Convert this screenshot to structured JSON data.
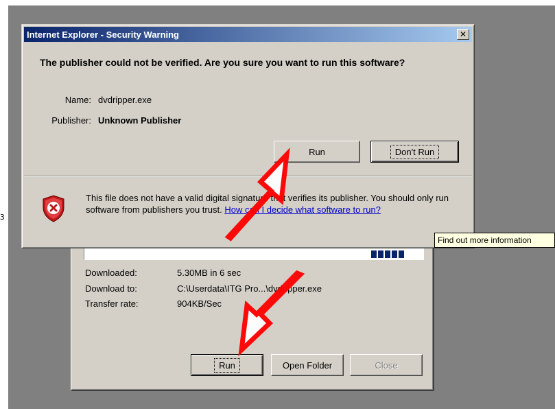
{
  "edge_mark": "3",
  "security_dialog": {
    "title": "Internet Explorer - Security Warning",
    "close_glyph": "✕",
    "question": "The publisher could not be verified.  Are you sure you want to run this software?",
    "name_label": "Name:",
    "name_value": "dvdripper.exe",
    "publisher_label": "Publisher:",
    "publisher_value": "Unknown Publisher",
    "run_button": "Run",
    "dont_run_button": "Don't Run",
    "warning_text": "This file does not have a valid digital signature that verifies its publisher. You should only run software from publishers you trust.",
    "help_link": "How can I decide what software to run?",
    "icon": "shield-x-icon"
  },
  "tooltip": "Find out more information",
  "download_dialog": {
    "progress": 0.98,
    "downloaded_label": "Downloaded:",
    "downloaded_value": "5.30MB in 6 sec",
    "download_to_label": "Download to:",
    "download_to_value": "C:\\Userdata\\ITG Pro...\\dvdripper.exe",
    "transfer_rate_label": "Transfer rate:",
    "transfer_rate_value": "904KB/Sec",
    "run_button": "Run",
    "open_folder_button": "Open Folder",
    "close_button": "Close"
  },
  "colors": {
    "desktop": "#808080",
    "dialog_face": "#d4d0c8",
    "title_start": "#0a246a",
    "title_end": "#a6caf0",
    "arrow": "#ff0000",
    "link": "#0000cc",
    "tooltip_bg": "#ffffe1"
  }
}
